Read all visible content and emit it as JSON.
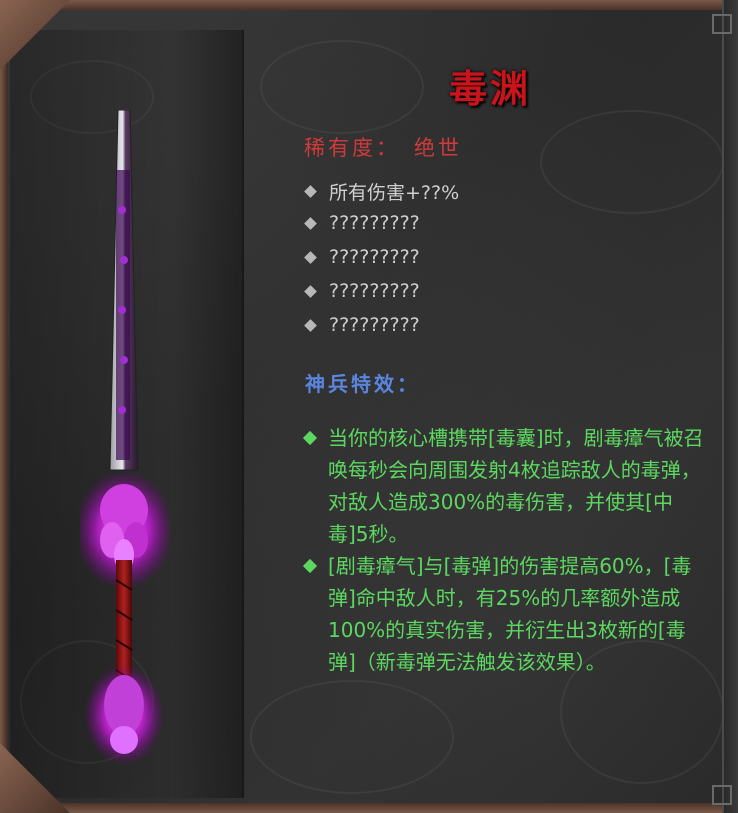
{
  "item": {
    "name": "毒渊",
    "rarity_label": "稀有度：",
    "rarity_value": "绝世"
  },
  "stats": [
    "所有伤害+??%",
    "?????????",
    "?????????",
    "?????????",
    "?????????"
  ],
  "special": {
    "title": "神兵特效：",
    "effects": [
      "当你的核心槽携带[毒囊]时，剧毒瘴气被召唤每秒会向周围发射4枚追踪敌人的毒弹，对敌人造成300%的毒伤害，并使其[中毒]5秒。",
      "[剧毒瘴气]与[毒弹]的伤害提高60%，[毒弹]命中敌人时，有25%的几率额外造成100%的真实伤害，并衍生出3枚新的[毒弹]（新毒弹无法触发该效果）。"
    ]
  },
  "colors": {
    "title": "#c8141a",
    "rarity": "#d03a3a",
    "special_title": "#5b86e0",
    "effect_text": "#5cd860",
    "stat_text": "#cfcfcf"
  },
  "icons": [
    "sword-icon",
    "diamond-bullet-icon",
    "green-diamond-bullet-icon"
  ]
}
